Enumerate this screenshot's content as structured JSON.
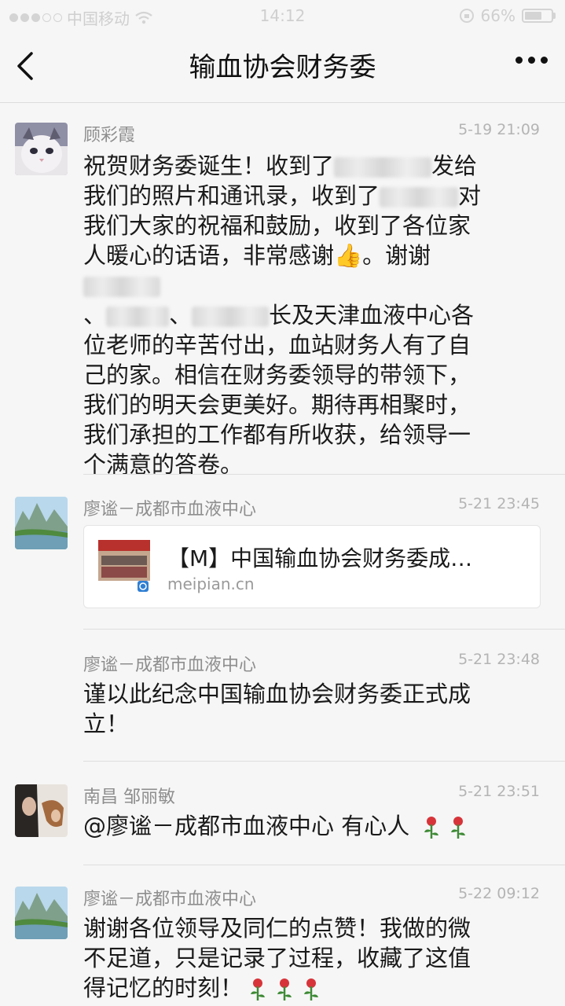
{
  "status_bar": {
    "carrier": "中国移动",
    "time": "14:12",
    "battery": "66%",
    "battery_level": 0.66
  },
  "nav": {
    "title": "输血协会财务委"
  },
  "comments": [
    {
      "name": "顾彩霞",
      "time": "5-19 21:09",
      "lines": [
        [
          "祝贺财务委诞生！收到了",
          "",
          "发给"
        ],
        [
          "我们的照片和通讯录，收到了",
          "",
          "对"
        ],
        [
          "我们大家的祝福和鼓励，收到了各位家"
        ],
        [
          "人暖心的话语，非常感谢",
          "👍",
          "。谢谢",
          ""
        ],
        [
          "、",
          "",
          "、",
          "",
          "长及天津血液中心各"
        ],
        [
          "位老师的辛苦付出，血站财务人有了自"
        ],
        [
          "己的家。相信在财务委领导的带领下，"
        ],
        [
          "我们的明天会更美好。期待再相聚时，"
        ],
        [
          "我们承担的工作都有所收获，给领导一"
        ],
        [
          "个满意的答卷。"
        ]
      ]
    },
    {
      "name": "廖谧－成都市血液中心",
      "time": "5-21 23:45",
      "link": {
        "title": "【M】中国输血协会财务委成…",
        "domain": "meipian.cn"
      }
    },
    {
      "name": "廖谧－成都市血液中心",
      "time": "5-21 23:48",
      "line1": "谨以此纪念中国输血协会财务委正式成",
      "line2": "立！"
    },
    {
      "name": "南昌 邹丽敏",
      "time": "5-21 23:51",
      "line1": "@廖谧－成都市血液中心 有心人"
    },
    {
      "name": "廖谧－成都市血液中心",
      "time": "5-22 09:12",
      "line1": "谢谢各位领导及同仁的点赞！我做的微",
      "line2": "不足道，只是记录了过程，收藏了这值",
      "line3": "得记忆的时刻！"
    }
  ],
  "icons": {
    "back": "chevron-left-icon",
    "more": "more-dots-icon",
    "flower": "rose-icon"
  }
}
